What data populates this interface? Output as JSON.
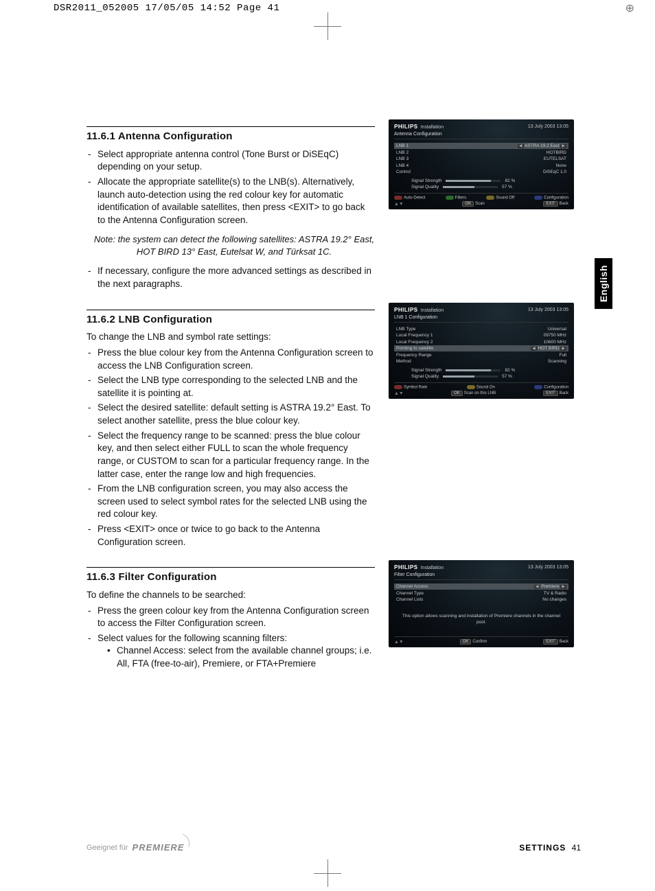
{
  "crop_header": "DSR2011_052005  17/05/05  14:52  Page 41",
  "language_tab": "English",
  "sections": {
    "s1": {
      "heading": "11.6.1  Antenna Configuration",
      "li1": "Select appropriate antenna control (Tone Burst or DiSEqC) depending on your setup.",
      "li2": "Allocate the appropriate satellite(s) to the LNB(s). Alternatively, launch auto-detection using the red colour key for automatic identification of available satellites, then press <EXIT> to go back to the Antenna Configuration screen.",
      "note": "Note: the system can detect the following satellites: ASTRA 19.2° East, HOT BIRD 13° East, Eutelsat W, and Türksat 1C.",
      "li3": "If necessary, configure the more advanced settings as described in the next paragraphs."
    },
    "s2": {
      "heading": "11.6.2  LNB Configuration",
      "intro": "To change the LNB and symbol rate settings:",
      "li1": "Press the blue colour key from the Antenna Configuration screen to access the LNB Configuration screen.",
      "li2": "Select the LNB type corresponding to the selected LNB and the satellite it is pointing at.",
      "li3": "Select the desired satellite: default setting is ASTRA 19.2° East. To select another satellite, press the blue colour key.",
      "li4": "Select the frequency range to be scanned: press the blue colour key, and then select either FULL to scan the whole frequency range, or CUSTOM to scan for a particular frequency range. In the latter case, enter the range low and high frequencies.",
      "li5": "From the LNB configuration screen, you may also access the screen used to select symbol rates for the selected LNB using the red colour key.",
      "li6": "Press <EXIT> once or twice to go back to the Antenna Configuration screen."
    },
    "s3": {
      "heading": "11.6.3  Filter Configuration",
      "intro": "To define the channels to be searched:",
      "li1": "Press the green colour key from the Antenna Configuration screen to access the Filter Configuration screen.",
      "li2": "Select values for the following scanning filters:",
      "sub1": "Channel Access: select from the available channel groups; i.e.  All, FTA (free-to-air), Premiere, or FTA+Premiere"
    }
  },
  "screens": {
    "common": {
      "brand": "PHILIPS",
      "brand_sub": "Installation",
      "datetime": "13 July 2003    13:05",
      "signal_strength_label": "Signal Strength",
      "signal_quality_label": "Signal Quality",
      "signal_strength_val": "82 %",
      "signal_quality_val": "57 %",
      "ok": "OK",
      "exit": "EXIT",
      "back": "Back",
      "configuration": "Configuration"
    },
    "antenna": {
      "title": "Antenna Configuration",
      "rows": {
        "lnb1": "LNB 1",
        "lnb1v": "ASTRA 19.2 East",
        "lnb2": "LNB 2",
        "lnb2v": "HOTBIRD",
        "lnb3": "LNB 3",
        "lnb3v": "EUTELSAT",
        "lnb4": "LNB 4",
        "lnb4v": "None",
        "control": "Control",
        "controlv": "DiSEqC 1.0"
      },
      "foot": {
        "auto": "Auto-Detect",
        "filters": "Filters",
        "sound": "Sound Off",
        "scan": "Scan"
      }
    },
    "lnb": {
      "title": "LNB 1 Configuration",
      "rows": {
        "type": "LNB Type",
        "typev": "Universal",
        "lf1": "Local Frequency 1",
        "lf1v": "09750 MHz",
        "lf2": "Local Frequency 2",
        "lf2v": "10600 MHz",
        "point": "Pointing to satellite",
        "pointv": "HOT BIRD",
        "range": "Frequency Range",
        "rangev": "Full",
        "method": "Method",
        "methodv": "Scanning"
      },
      "foot": {
        "symbol": "Symbol Rate",
        "sound": "Sound On",
        "scan": "Scan on this LNB"
      }
    },
    "filter": {
      "title": "Filter Configuration",
      "rows": {
        "access": "Channel Access",
        "accessv": "Premiere",
        "ctype": "Channel Type",
        "ctypev": "TV & Radio",
        "clists": "Channel Lists",
        "clistsv": "No changes"
      },
      "msg": "This option allows scanning and installation of Premiere channels in the channel pool.",
      "confirm": "Confirm"
    }
  },
  "footer": {
    "suited": "Geeignet für",
    "logo": "PREMIERE",
    "section": "SETTINGS",
    "page": "41"
  }
}
